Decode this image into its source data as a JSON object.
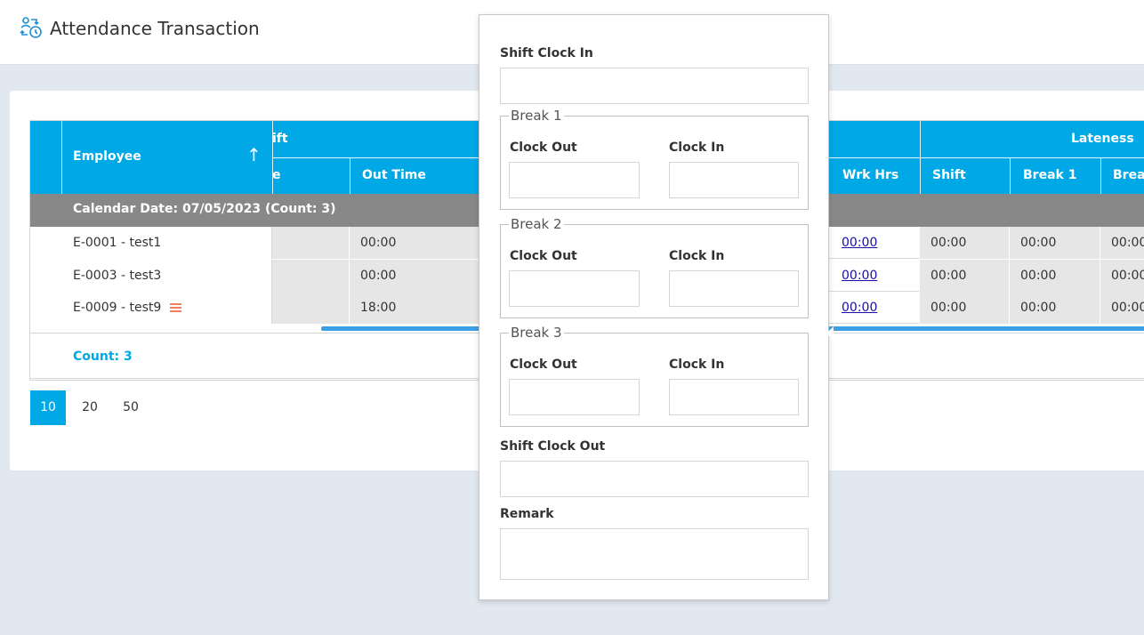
{
  "page": {
    "title": "Attendance Transaction",
    "title_icon": "attendance-icon"
  },
  "grid": {
    "headers": {
      "employee": "Employee",
      "sort_icon": "↑",
      "shift_group": "ift",
      "time_in_partial": "e",
      "out_time": "Out Time",
      "wrk_hrs": "Wrk Hrs",
      "lateness": "Lateness",
      "shift": "Shift",
      "break1": "Break 1",
      "break_partial": "Brea"
    },
    "group_label": "Calendar Date: 07/05/2023 (Count: 3)",
    "rows": [
      {
        "employee": "E-0001 - test1",
        "in_time": "",
        "out_time": "00:00",
        "wrk_hrs": "00:00",
        "late_shift": "00:00",
        "late_break1": "00:00",
        "late_break_partial": "00:00",
        "has_menu": false
      },
      {
        "employee": "E-0003 - test3",
        "in_time": "",
        "out_time": "00:00",
        "wrk_hrs": "00:00",
        "late_shift": "00:00",
        "late_break1": "00:00",
        "late_break_partial": "00:00",
        "has_menu": false
      },
      {
        "employee": "E-0009 - test9",
        "in_time": "",
        "out_time": "18:00",
        "wrk_hrs": "00:00",
        "late_shift": "00:00",
        "late_break1": "00:00",
        "late_break_partial": "00:00",
        "has_menu": true
      }
    ],
    "footer_count": "Count: 3"
  },
  "pager": {
    "sizes": [
      "10",
      "20",
      "50"
    ],
    "active": "10"
  },
  "popup": {
    "shift_clock_in": "Shift Clock In",
    "break1": {
      "legend": "Break 1",
      "clock_out": "Clock Out",
      "clock_in": "Clock In"
    },
    "break2": {
      "legend": "Break 2",
      "clock_out": "Clock Out",
      "clock_in": "Clock In"
    },
    "break3": {
      "legend": "Break 3",
      "clock_out": "Clock Out",
      "clock_in": "Clock In"
    },
    "shift_clock_out": "Shift Clock Out",
    "remark": "Remark"
  },
  "colors": {
    "accent": "#00a8e6",
    "group_bar": "#888888",
    "menu_icon": "#f0805a"
  }
}
